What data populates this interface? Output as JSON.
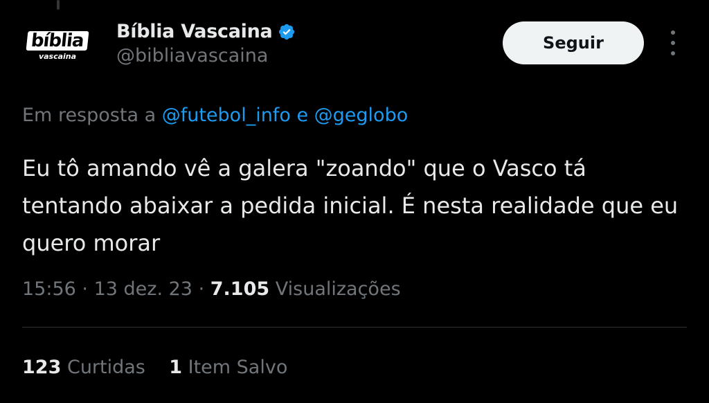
{
  "author": {
    "display_name": "Bíblia Vascaina",
    "handle": "@bibliavascaina",
    "avatar_logo_main": "bíblia",
    "avatar_logo_sub": "vascaina",
    "verified": true
  },
  "actions": {
    "follow_label": "Seguir",
    "more_icon": "more-dots-vertical"
  },
  "reply": {
    "prefix": "Em resposta a",
    "mention_1": "@futebol_info",
    "joiner": "e",
    "mention_2": "@geglobo"
  },
  "tweet": {
    "text": "Eu tô amando vê a galera \"zoando\" que o Vasco tá tentando abaixar a pedida inicial. É nesta realidade que eu quero morar"
  },
  "meta": {
    "time": "15:56",
    "sep": "·",
    "date": "13 dez. 23",
    "views_count": "7.105",
    "views_label": "Visualizações"
  },
  "stats": {
    "likes_count": "123",
    "likes_label": "Curtidas",
    "bookmarks_count": "1",
    "bookmarks_label": "Item Salvo"
  },
  "colors": {
    "background": "#000000",
    "text_primary": "#e7e9ea",
    "text_secondary": "#71767b",
    "link": "#1d9bf0",
    "divider": "#2f3336",
    "button_bg": "#eff3f4"
  }
}
